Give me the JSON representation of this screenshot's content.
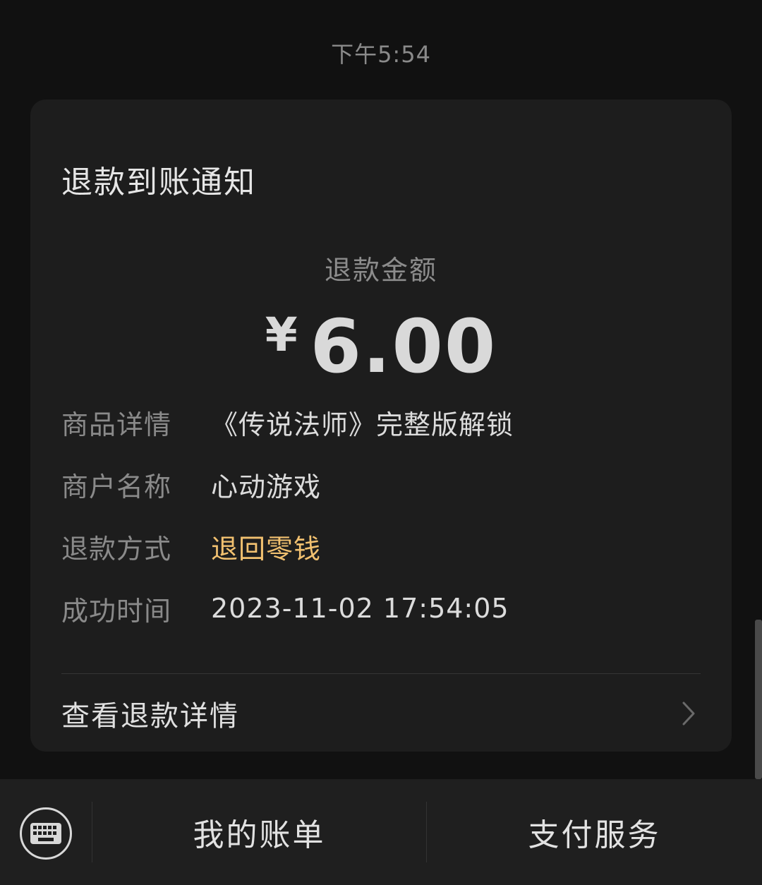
{
  "status": {
    "time": "下午5:54"
  },
  "card": {
    "title": "退款到账通知",
    "amount_label": "退款金额",
    "currency_symbol": "¥",
    "amount": "6.00",
    "rows": [
      {
        "label": "商品详情",
        "value": "《传说法师》完整版解锁"
      },
      {
        "label": "商户名称",
        "value": "心动游戏"
      },
      {
        "label": "退款方式",
        "value": "退回零钱"
      },
      {
        "label": "成功时间",
        "value": "2023-11-02 17:54:05"
      }
    ],
    "detail_link": "查看退款详情"
  },
  "bottom_bar": {
    "my_bill": "我的账单",
    "payment_service": "支付服务"
  },
  "colors": {
    "accent": "#f2c170",
    "background": "#111111",
    "card": "#1d1d1d"
  },
  "icons": {
    "keyboard": "keyboard-icon",
    "chevron": "chevron-right-icon"
  }
}
